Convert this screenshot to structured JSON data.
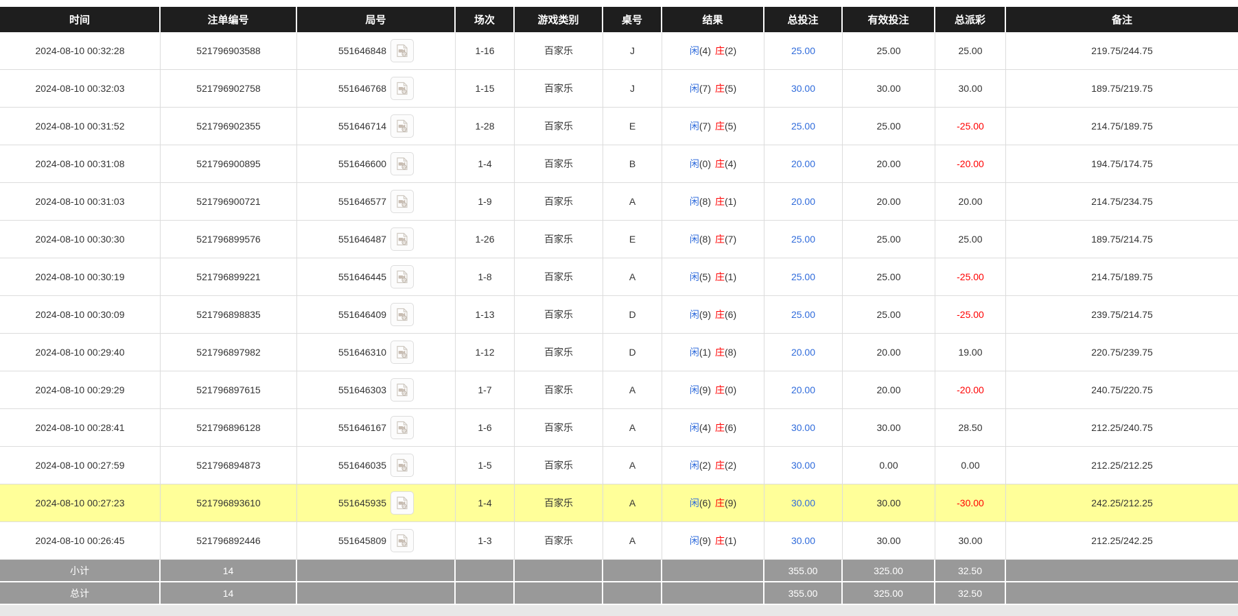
{
  "colors": {
    "header_bg": "#1e1e1e",
    "accent_blue": "#2f6bdb",
    "accent_red": "#ff0000",
    "highlight_row": "#ffff99",
    "footer_bg": "#999999"
  },
  "table": {
    "columns": [
      "时间",
      "注单编号",
      "局号",
      "场次",
      "游戏类别",
      "桌号",
      "结果",
      "总投注",
      "有效投注",
      "总派彩",
      "备注"
    ],
    "result_labels": {
      "player": "闲",
      "banker": "庄"
    },
    "video_icon": "video-camera-icon",
    "rows": [
      {
        "time": "2024-08-10 00:32:28",
        "bet_id": "521796903588",
        "round_id": "551646848",
        "session": "1-16",
        "game_type": "百家乐",
        "table_code": "J",
        "result": {
          "player": "4",
          "banker": "2"
        },
        "total_bet": "25.00",
        "valid_bet": "25.00",
        "total_payout": "25.00",
        "remark": "219.75/244.75",
        "highlighted": false
      },
      {
        "time": "2024-08-10 00:32:03",
        "bet_id": "521796902758",
        "round_id": "551646768",
        "session": "1-15",
        "game_type": "百家乐",
        "table_code": "J",
        "result": {
          "player": "7",
          "banker": "5"
        },
        "total_bet": "30.00",
        "valid_bet": "30.00",
        "total_payout": "30.00",
        "remark": "189.75/219.75",
        "highlighted": false
      },
      {
        "time": "2024-08-10 00:31:52",
        "bet_id": "521796902355",
        "round_id": "551646714",
        "session": "1-28",
        "game_type": "百家乐",
        "table_code": "E",
        "result": {
          "player": "7",
          "banker": "5"
        },
        "total_bet": "25.00",
        "valid_bet": "25.00",
        "total_payout": "-25.00",
        "remark": "214.75/189.75",
        "highlighted": false
      },
      {
        "time": "2024-08-10 00:31:08",
        "bet_id": "521796900895",
        "round_id": "551646600",
        "session": "1-4",
        "game_type": "百家乐",
        "table_code": "B",
        "result": {
          "player": "0",
          "banker": "4"
        },
        "total_bet": "20.00",
        "valid_bet": "20.00",
        "total_payout": "-20.00",
        "remark": "194.75/174.75",
        "highlighted": false
      },
      {
        "time": "2024-08-10 00:31:03",
        "bet_id": "521796900721",
        "round_id": "551646577",
        "session": "1-9",
        "game_type": "百家乐",
        "table_code": "A",
        "result": {
          "player": "8",
          "banker": "1"
        },
        "total_bet": "20.00",
        "valid_bet": "20.00",
        "total_payout": "20.00",
        "remark": "214.75/234.75",
        "highlighted": false
      },
      {
        "time": "2024-08-10 00:30:30",
        "bet_id": "521796899576",
        "round_id": "551646487",
        "session": "1-26",
        "game_type": "百家乐",
        "table_code": "E",
        "result": {
          "player": "8",
          "banker": "7"
        },
        "total_bet": "25.00",
        "valid_bet": "25.00",
        "total_payout": "25.00",
        "remark": "189.75/214.75",
        "highlighted": false
      },
      {
        "time": "2024-08-10 00:30:19",
        "bet_id": "521796899221",
        "round_id": "551646445",
        "session": "1-8",
        "game_type": "百家乐",
        "table_code": "A",
        "result": {
          "player": "5",
          "banker": "1"
        },
        "total_bet": "25.00",
        "valid_bet": "25.00",
        "total_payout": "-25.00",
        "remark": "214.75/189.75",
        "highlighted": false
      },
      {
        "time": "2024-08-10 00:30:09",
        "bet_id": "521796898835",
        "round_id": "551646409",
        "session": "1-13",
        "game_type": "百家乐",
        "table_code": "D",
        "result": {
          "player": "9",
          "banker": "6"
        },
        "total_bet": "25.00",
        "valid_bet": "25.00",
        "total_payout": "-25.00",
        "remark": "239.75/214.75",
        "highlighted": false
      },
      {
        "time": "2024-08-10 00:29:40",
        "bet_id": "521796897982",
        "round_id": "551646310",
        "session": "1-12",
        "game_type": "百家乐",
        "table_code": "D",
        "result": {
          "player": "1",
          "banker": "8"
        },
        "total_bet": "20.00",
        "valid_bet": "20.00",
        "total_payout": "19.00",
        "remark": "220.75/239.75",
        "highlighted": false
      },
      {
        "time": "2024-08-10 00:29:29",
        "bet_id": "521796897615",
        "round_id": "551646303",
        "session": "1-7",
        "game_type": "百家乐",
        "table_code": "A",
        "result": {
          "player": "9",
          "banker": "0"
        },
        "total_bet": "20.00",
        "valid_bet": "20.00",
        "total_payout": "-20.00",
        "remark": "240.75/220.75",
        "highlighted": false
      },
      {
        "time": "2024-08-10 00:28:41",
        "bet_id": "521796896128",
        "round_id": "551646167",
        "session": "1-6",
        "game_type": "百家乐",
        "table_code": "A",
        "result": {
          "player": "4",
          "banker": "6"
        },
        "total_bet": "30.00",
        "valid_bet": "30.00",
        "total_payout": "28.50",
        "remark": "212.25/240.75",
        "highlighted": false
      },
      {
        "time": "2024-08-10 00:27:59",
        "bet_id": "521796894873",
        "round_id": "551646035",
        "session": "1-5",
        "game_type": "百家乐",
        "table_code": "A",
        "result": {
          "player": "2",
          "banker": "2"
        },
        "total_bet": "30.00",
        "valid_bet": "0.00",
        "total_payout": "0.00",
        "remark": "212.25/212.25",
        "highlighted": false
      },
      {
        "time": "2024-08-10 00:27:23",
        "bet_id": "521796893610",
        "round_id": "551645935",
        "session": "1-4",
        "game_type": "百家乐",
        "table_code": "A",
        "result": {
          "player": "6",
          "banker": "9"
        },
        "total_bet": "30.00",
        "valid_bet": "30.00",
        "total_payout": "-30.00",
        "remark": "242.25/212.25",
        "highlighted": true
      },
      {
        "time": "2024-08-10 00:26:45",
        "bet_id": "521796892446",
        "round_id": "551645809",
        "session": "1-3",
        "game_type": "百家乐",
        "table_code": "A",
        "result": {
          "player": "9",
          "banker": "1"
        },
        "total_bet": "30.00",
        "valid_bet": "30.00",
        "total_payout": "30.00",
        "remark": "212.25/242.25",
        "highlighted": false
      }
    ],
    "footer": [
      {
        "label": "小计",
        "count": "14",
        "total_bet": "355.00",
        "valid_bet": "325.00",
        "total_payout": "32.50"
      },
      {
        "label": "总计",
        "count": "14",
        "total_bet": "355.00",
        "valid_bet": "325.00",
        "total_payout": "32.50"
      }
    ]
  }
}
